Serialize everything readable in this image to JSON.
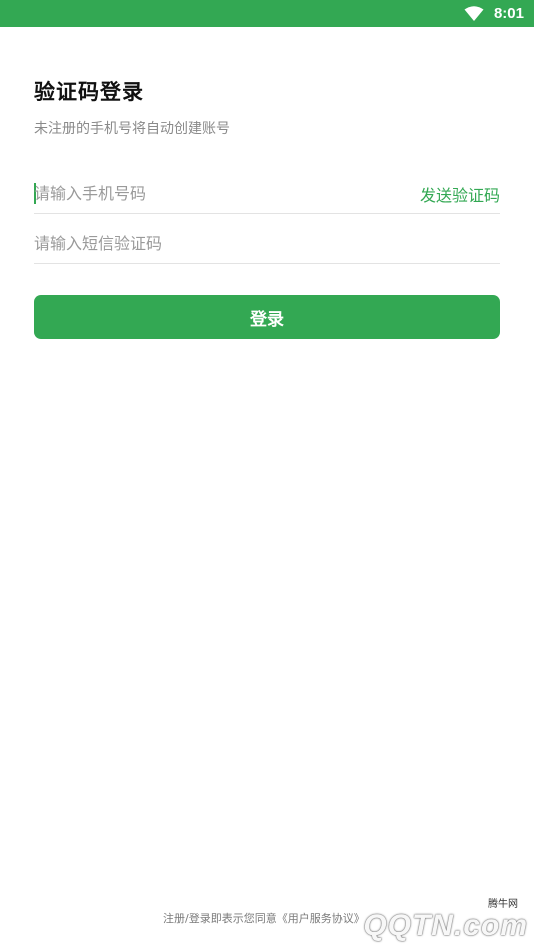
{
  "status_bar": {
    "time": "8:01",
    "color": "#33a853"
  },
  "login": {
    "title": "验证码登录",
    "subtitle": "未注册的手机号将自动创建账号",
    "phone_placeholder": "请输入手机号码",
    "send_code_label": "发送验证码",
    "code_placeholder": "请输入短信验证码",
    "submit_label": "登录"
  },
  "footer": {
    "agreement_prefix": "注册/登录即表示您同意",
    "agreement_link": "《用户服务协议》"
  },
  "watermark": {
    "brand": "QQTN.com",
    "sub": "腾牛网"
  },
  "theme": {
    "accent": "#33a853"
  }
}
